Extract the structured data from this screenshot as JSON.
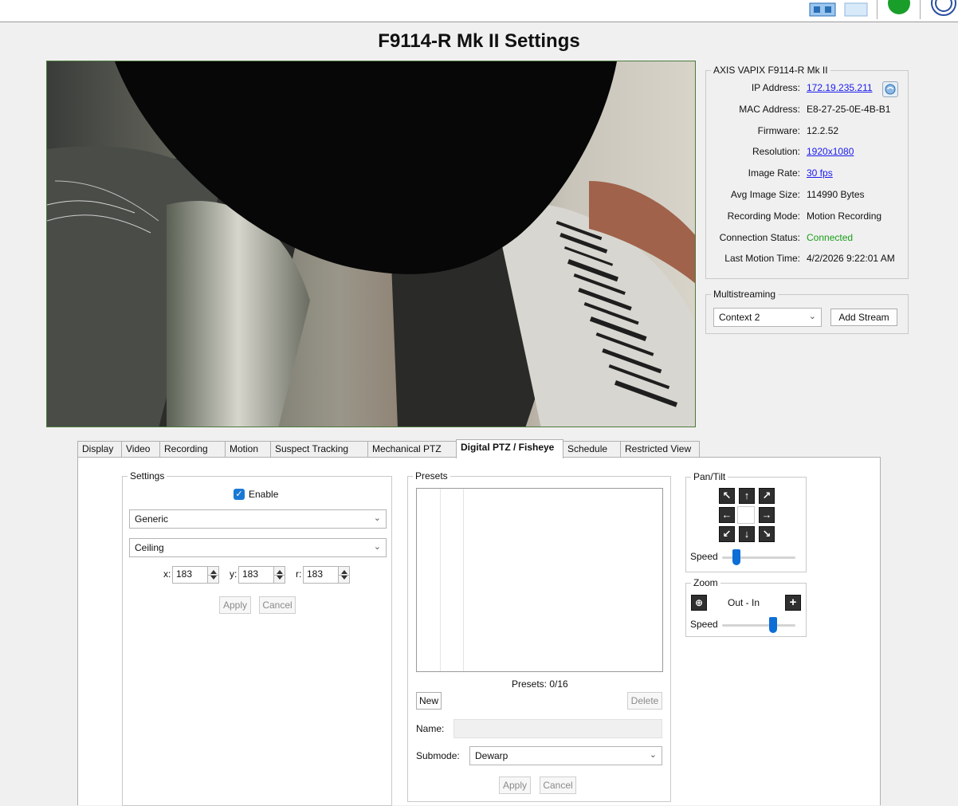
{
  "page_title": "F9114-R Mk II Settings",
  "toolbar": {
    "icons": [
      "monitor-icon",
      "blank-tile-icon",
      "green-status-icon",
      "blue-globe-icon"
    ]
  },
  "info": {
    "group_title": "AXIS VAPIX F9114-R Mk II",
    "rows": [
      {
        "label": "IP Address:",
        "value": "172.19.235.211",
        "link": true
      },
      {
        "label": "MAC Address:",
        "value": "E8-27-25-0E-4B-B1"
      },
      {
        "label": "Firmware:",
        "value": "12.2.52"
      },
      {
        "label": "Resolution:",
        "value": "1920x1080",
        "link": true
      },
      {
        "label": "Image Rate:",
        "value": "30 fps",
        "link": true
      },
      {
        "label": "Avg Image Size:",
        "value": "114990 Bytes"
      },
      {
        "label": "Recording Mode:",
        "value": "Motion Recording"
      },
      {
        "label": "Connection Status:",
        "value": "Connected",
        "color": "#1a9e1a"
      },
      {
        "label": "Last Motion Time:",
        "value": "4/2/2026 9:22:01 AM"
      }
    ]
  },
  "multistreaming": {
    "title": "Multistreaming",
    "selected": "Context 2",
    "add_button": "Add Stream"
  },
  "tabs": [
    {
      "label": "Display"
    },
    {
      "label": "Video"
    },
    {
      "label": "Recording"
    },
    {
      "label": "Motion"
    },
    {
      "label": "Suspect Tracking"
    },
    {
      "label": "Mechanical PTZ"
    },
    {
      "label": "Digital PTZ / Fisheye",
      "active": true
    },
    {
      "label": "Schedule"
    },
    {
      "label": "Restricted View"
    }
  ],
  "settings": {
    "title": "Settings",
    "enable_label": "Enable",
    "enabled": true,
    "lens_select": "Generic",
    "mount_select": "Ceiling",
    "x_label": "x:",
    "x_value": "183",
    "y_label": "y:",
    "y_value": "183",
    "r_label": "r:",
    "r_value": "183",
    "apply": "Apply",
    "cancel": "Cancel"
  },
  "presets": {
    "title": "Presets",
    "count_text": "Presets: 0/16",
    "new_button": "New",
    "delete_button": "Delete",
    "name_label": "Name:",
    "name_value": "",
    "submode_label": "Submode:",
    "submode_value": "Dewarp",
    "apply": "Apply",
    "cancel": "Cancel"
  },
  "pan_tilt": {
    "title": "Pan/Tilt",
    "speed_label": "Speed",
    "speed_level": 0.2
  },
  "zoom": {
    "title": "Zoom",
    "label": "Out - In",
    "speed_label": "Speed",
    "speed_level": 0.7
  },
  "colors": {
    "accent": "#1979d4",
    "link": "#1a1aee",
    "connected": "#1a9e1a"
  }
}
